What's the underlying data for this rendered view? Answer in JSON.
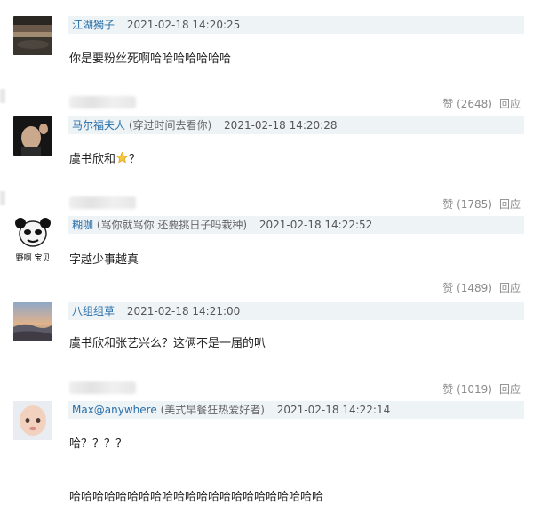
{
  "comments": [
    {
      "username": "江湖獨子",
      "note": "",
      "time": "2021-02-18 14:20:25",
      "text": "你是要粉丝死啊哈哈哈哈哈哈哈",
      "likes": "赞 (2648)",
      "reply": "回应"
    },
    {
      "username": "马尔福夫人",
      "note": "(穿过时间去看你)",
      "time": "2021-02-18 14:20:28",
      "text": "虞书欣和",
      "text_suffix": "？",
      "likes": "赞 (1785)",
      "reply": "回应"
    },
    {
      "username": "糊咖",
      "note": "(骂你就骂你 还要挑日子吗栽种)",
      "time": "2021-02-18 14:22:52",
      "text": "字越少事越真",
      "avatar_caption": "野啊 宝贝",
      "likes": "赞 (1489)",
      "reply": "回应"
    },
    {
      "username": "八组组草",
      "note": "",
      "time": "2021-02-18 14:21:00",
      "text": "虞书欣和张艺兴么？这俩不是一届的叭",
      "likes": "赞 (1019)",
      "reply": "回应"
    },
    {
      "username": "Max@anywhere",
      "note": "(美式早餐狂热爱好者)",
      "time": "2021-02-18 14:22:14",
      "text": "哈？？？？",
      "text2": "哈哈哈哈哈哈哈哈哈哈哈哈哈哈哈哈哈哈哈哈哈哈"
    }
  ],
  "colors": {
    "header_bg": "#eef3f6",
    "username": "#2a6fa8",
    "muted": "#8a8a8a"
  }
}
